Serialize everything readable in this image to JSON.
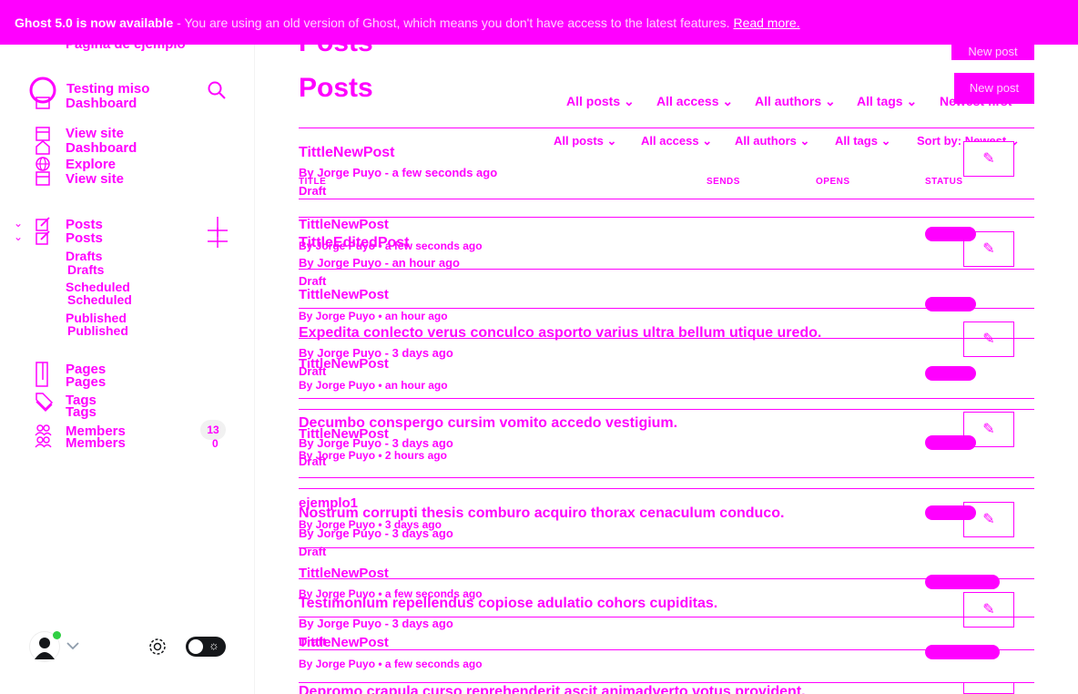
{
  "banner": {
    "title": "Ghost 5.0 is now available",
    "message": " - You are using an old version of Ghost, which means you don't have access to the latest features.",
    "link": "Read more."
  },
  "sidebar": {
    "site_ghost": "Página de ejemplo",
    "site_name": "Testing miso",
    "dashboard": "Dashboard",
    "view_site": "View site",
    "explore": "Explore",
    "posts": "Posts",
    "drafts": "Drafts",
    "scheduled": "Scheduled",
    "published": "Published",
    "pages": "Pages",
    "tags": "Tags",
    "members": "Members",
    "members_count": "13",
    "members_count_ghost": "0"
  },
  "main": {
    "title": "Posts",
    "new_post": "New post",
    "filters": {
      "all_posts": "All posts",
      "all_access": "All access",
      "all_authors": "All authors",
      "all_tags": "All tags",
      "sort": "Sort by: Newest",
      "sort_ghost": "Newest first"
    },
    "columns": {
      "title": "TITLE",
      "sends": "SENDS",
      "opens": "OPENS",
      "status": "STATUS"
    },
    "posts": [
      {
        "title": "TittleNewPost",
        "meta": "By Jorge Puyo - a few seconds ago",
        "status": "Draft"
      },
      {
        "title": "TittleEditedPost",
        "meta": "By Jorge Puyo - an hour ago",
        "status": "Draft"
      },
      {
        "title": "Expedita conlecto verus conculco asporto varius ultra bellum utique uredo.",
        "meta": "By Jorge Puyo - 3 days ago",
        "status": "Draft"
      },
      {
        "title": "Decumbo conspergo cursim vomito accedo vestigium.",
        "meta": "By Jorge Puyo - 3 days ago",
        "status": "Draft"
      },
      {
        "title": "Nostrum corrupti thesis comburo acquiro thorax cenaculum conduco.",
        "meta": "By Jorge Puyo - 3 days ago",
        "status": "Draft"
      },
      {
        "title": "Testimonium repellendus copiose adulatio cohors cupiditas.",
        "meta": "By Jorge Puyo - 3 days ago",
        "status": "Draft"
      },
      {
        "title": "Depromo crapula curso reprehenderit ascit animadverto votus provident.",
        "meta": "",
        "status": ""
      }
    ],
    "ghost_posts": [
      {
        "title": "TittleNewPost",
        "meta": "By Jorge Puyo • a few seconds ago"
      },
      {
        "title": "TittleNewPost",
        "meta": "By Jorge Puyo • an hour ago"
      },
      {
        "title": "TittleNewPost",
        "meta": "By Jorge Puyo • an hour ago"
      },
      {
        "title": "TittleNewPost",
        "meta": "By Jorge Puyo • 2 hours ago"
      },
      {
        "title": "ejemplo1",
        "meta": "By Jorge Puyo • 3 days ago"
      },
      {
        "title": "TittleNewPost",
        "meta": "By Jorge Puyo • a few seconds ago"
      },
      {
        "title": "TittleNewPost",
        "meta": "By Jorge Puyo • a few seconds ago"
      }
    ]
  },
  "colors": {
    "accent": "#ff00ff",
    "online": "#30cf43"
  }
}
